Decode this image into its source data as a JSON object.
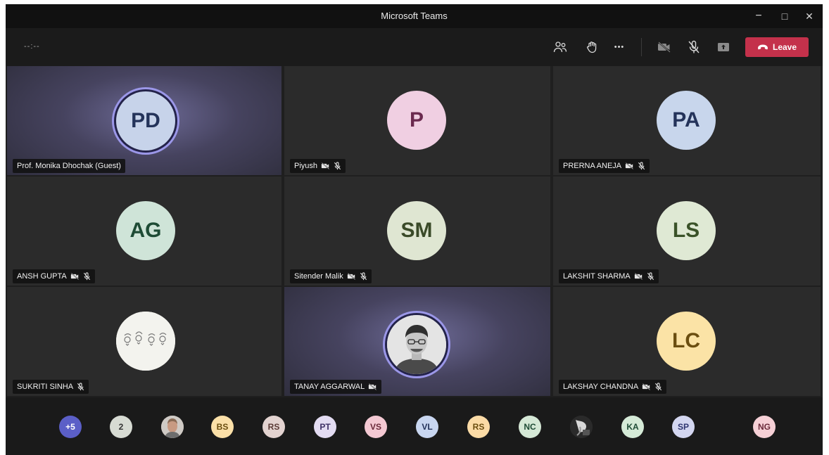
{
  "window": {
    "title": "Microsoft Teams"
  },
  "window_controls": {
    "minimize": "−",
    "maximize": "□",
    "close": "✕"
  },
  "toolbar": {
    "timer": "--:--",
    "leave_label": "Leave",
    "more_label": "•••"
  },
  "tiles": [
    {
      "name": "Prof. Monika Dhochak (Guest)",
      "initials": "PD",
      "avatar_bg": "#c7d3ea",
      "avatar_fg": "#24335a",
      "speaking": true,
      "video_off": false,
      "muted": false
    },
    {
      "name": "Piyush",
      "initials": "P",
      "avatar_bg": "#f0cfe2",
      "avatar_fg": "#6b2a4f",
      "video_off": true,
      "muted": true
    },
    {
      "name": "PRERNA ANEJA",
      "initials": "PA",
      "avatar_bg": "#c8d6ec",
      "avatar_fg": "#24335a",
      "video_off": true,
      "muted": true
    },
    {
      "name": "ANSH GUPTA",
      "initials": "AG",
      "avatar_bg": "#cfe4d8",
      "avatar_fg": "#1e4b35",
      "video_off": true,
      "muted": true
    },
    {
      "name": "Sitender Malik",
      "initials": "SM",
      "avatar_bg": "#dfe6d2",
      "avatar_fg": "#3a4a28",
      "video_off": true,
      "muted": true
    },
    {
      "name": "LAKSHIT SHARMA",
      "initials": "LS",
      "avatar_bg": "#dfe9d4",
      "avatar_fg": "#3a5228",
      "video_off": true,
      "muted": true
    },
    {
      "name": "SUKRITI SINHA",
      "initials": "",
      "avatar_bg": "#f1f1ec",
      "avatar_fg": "#555555",
      "video_off": false,
      "muted": true
    },
    {
      "name": "TANAY AGGARWAL",
      "initials": "",
      "avatar_bg": "#d9d9d9",
      "avatar_fg": "#333333",
      "speaking": true,
      "video_off": true,
      "muted": false
    },
    {
      "name": "LAKSHAY CHANDNA",
      "initials": "LC",
      "avatar_bg": "#fbe3a6",
      "avatar_fg": "#6b4e10",
      "video_off": true,
      "muted": true
    }
  ],
  "participants_strip": [
    {
      "label": "+5",
      "bg": "#5b5fc7",
      "fg": "#ffffff"
    },
    {
      "label": "2",
      "bg": "#d7dbd3",
      "fg": "#333333"
    },
    {
      "label": "",
      "bg": "#b7aaa0",
      "fg": "#333333",
      "photo": true
    },
    {
      "label": "BS",
      "bg": "#fbe0a8",
      "fg": "#6b4e10"
    },
    {
      "label": "RS",
      "bg": "#e3d3d0",
      "fg": "#5a3a35"
    },
    {
      "label": "PT",
      "bg": "#e3dcf2",
      "fg": "#3e3066"
    },
    {
      "label": "VS",
      "bg": "#f4c9d3",
      "fg": "#6b2a3a"
    },
    {
      "label": "VL",
      "bg": "#c8d6f0",
      "fg": "#24335a"
    },
    {
      "label": "RS",
      "bg": "#fbdba6",
      "fg": "#6b4e10"
    },
    {
      "label": "NC",
      "bg": "#d5e8d6",
      "fg": "#1e4b35"
    },
    {
      "label": "",
      "bg": "#2e2e2e",
      "fg": "#ffffff",
      "photo": true
    },
    {
      "label": "KA",
      "bg": "#d5ead7",
      "fg": "#1e4b35"
    },
    {
      "label": "SP",
      "bg": "#d3d6f0",
      "fg": "#2f3570"
    },
    {
      "label": "NG",
      "bg": "#f6d0d6",
      "fg": "#6b2a3a"
    }
  ],
  "colors": {
    "accent": "#5b5fc7",
    "leave": "#c4314b",
    "speaking_ring": "#9b97e8"
  }
}
